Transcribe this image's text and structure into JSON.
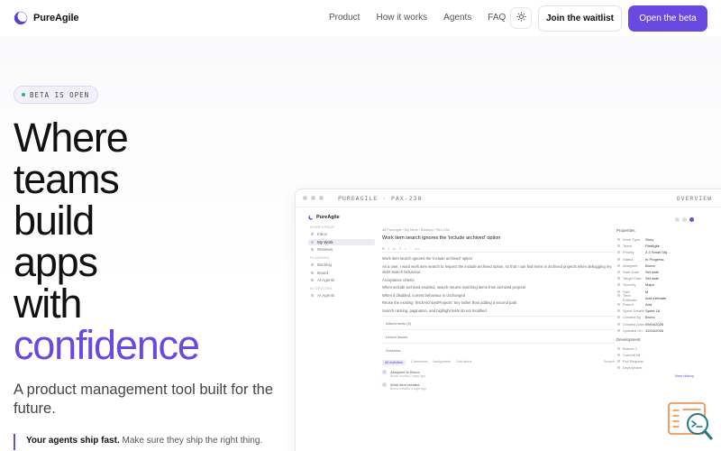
{
  "nav": {
    "brand": "PureAgile",
    "links": [
      "Product",
      "How it works",
      "Agents",
      "FAQ"
    ],
    "waitlist_label": "Join the waitlist",
    "beta_label": "Open the beta"
  },
  "hero": {
    "badge": "BETA IS OPEN",
    "headline_lines": [
      "Where",
      "teams",
      "build",
      "apps",
      "with"
    ],
    "headline_accent": "confidence",
    "subtitle": "A product management tool built for the future.",
    "tagline_strong": "Your agents ship fast.",
    "tagline_rest": "Make sure they ship the right thing."
  },
  "preview": {
    "window_title": "PUREAGILE · PAX-238",
    "overview_label": "OVERVIEW",
    "brand": "PureAgile",
    "sidebar": {
      "workspace_label": "WORKSPACE",
      "workspace_items": [
        "Inbox",
        "My Work",
        "Reviews"
      ],
      "planning_label": "PLANNING",
      "planning_items": [
        "Backlog",
        "Board",
        "AI Agents"
      ],
      "settings_label": "AI OPTIONS",
      "settings_items": [
        "AI Agents"
      ]
    },
    "breadcrumb": "All PureAgile  /  My Work  /  Backlog  /  PAX-238",
    "issue_title": "Work item search ignores the 'include archived' option",
    "toolbar": [
      "B",
      "I",
      "U",
      "≡",
      "•",
      "“",
      "</>"
    ],
    "body_intro": "Work item search ignores the 'include archived' option",
    "body_detail": "As a user, I want work item search to respect the include archived option, so that I can find items in archived projects when debugging my older search behaviour.",
    "acceptance_label": "Acceptance criteria",
    "criteria": [
      "When include archived enabled, search returns matching items from archived projects",
      "When it disabled, current behaviour is unchanged",
      "Reuse the existing `fetchArchivedProjects` key rather than adding a second path",
      "Search ranking, pagination, and highlight tests do not modified"
    ],
    "collapsibles": [
      "Attachments (0)",
      "Linked issues",
      "Subtasks"
    ],
    "activity_tabs": [
      "All Activities",
      "Comments",
      "Assignment",
      "Sub-items"
    ],
    "activity_search": "Search",
    "activity": [
      {
        "text": "Assigned to Bruno",
        "meta": "Bruno moved 2 days ago"
      },
      {
        "text": "Work item created",
        "meta": "Bruno created 4 days ago"
      }
    ],
    "properties_label": "Properties",
    "properties": [
      {
        "key": "Work Type",
        "value": "Story"
      },
      {
        "key": "Team",
        "value": "PlatAgile"
      },
      {
        "key": "Priority",
        "value": "2-3 Small Obj…"
      },
      {
        "key": "Status",
        "value": "In Progress"
      },
      {
        "key": "Assignee",
        "value": "Bruno"
      },
      {
        "key": "Start Date",
        "value": "Set date"
      },
      {
        "key": "Target Date",
        "value": "Set date"
      },
      {
        "key": "Severity",
        "value": "Major"
      },
      {
        "key": "Size",
        "value": "M"
      },
      {
        "key": "Time Estimate",
        "value": "Add estimate"
      },
      {
        "key": "Parent",
        "value": "Add"
      },
      {
        "key": "Sprint Details",
        "value": "Sprint 18"
      },
      {
        "key": "Created By",
        "value": "Bruno"
      },
      {
        "key": "Created Date",
        "value": "09/04/2026"
      },
      {
        "key": "Updated On",
        "value": "12/04/2026"
      }
    ],
    "development_label": "Development",
    "development": [
      "Branch 1",
      "Commit 28",
      "Pull Request",
      "Deployment"
    ],
    "history_link": "View history"
  },
  "colors": {
    "accent": "#6a49e0",
    "badge_dot": "#2bb673",
    "fab_orange": "#f0873c",
    "fab_teal": "#1f7a80"
  }
}
